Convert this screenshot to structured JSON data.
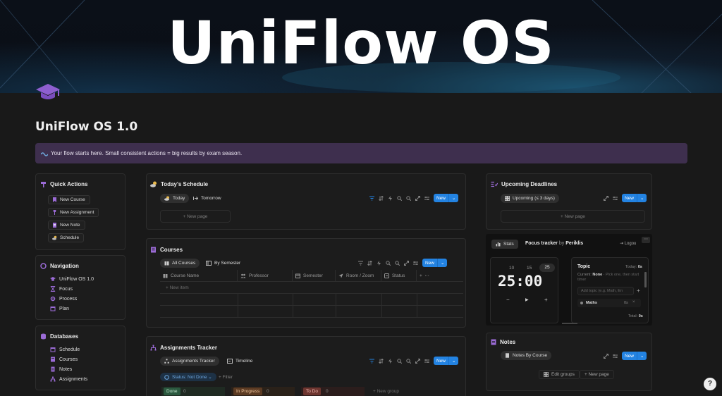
{
  "banner": {
    "title": "UniFlow OS"
  },
  "page": {
    "title": "UniFlow OS 1.0"
  },
  "callout": {
    "text": "Your flow starts here. Small consistent actions = big results by exam season."
  },
  "quick_actions": {
    "title": "Quick Actions",
    "buttons": [
      "New Course",
      "New Assignment",
      "New Note",
      "Schedule"
    ]
  },
  "navigation": {
    "title": "Navigation",
    "items": [
      "UniFlow OS 1.0",
      "Focus",
      "Process",
      "Plan"
    ]
  },
  "databases": {
    "title": "Databases",
    "items": [
      "Schedule",
      "Courses",
      "Notes",
      "Assignments"
    ]
  },
  "schedule": {
    "title": "Today's Schedule",
    "views": [
      "Today",
      "Tomorrow"
    ],
    "new_label": "New",
    "new_page": "New page"
  },
  "courses": {
    "title": "Courses",
    "views": [
      "All Courses",
      "By Semester"
    ],
    "new_label": "New",
    "columns": [
      "Course Name",
      "Professor",
      "Semester",
      "Room / Zoom",
      "Status"
    ],
    "new_item": "New item"
  },
  "assignments": {
    "title": "Assignments Tracker",
    "views": [
      "Assignments Tracker",
      "Timeline"
    ],
    "new_label": "New",
    "filter_status": "Status: Not Done",
    "filter_add": "Filter",
    "groups": [
      {
        "name": "Done",
        "count": "0",
        "color": "#2b593f"
      },
      {
        "name": "In Progress",
        "count": "0",
        "color": "#5c3b23"
      },
      {
        "name": "To Do",
        "count": "0",
        "color": "#6e3630"
      }
    ],
    "new_group": "New group"
  },
  "deadlines": {
    "title": "Upcoming Deadlines",
    "view": "Upcoming (≤ 3 days)",
    "new_label": "New",
    "new_page": "New page"
  },
  "focus_tracker": {
    "tab": "Stats",
    "title": "Focus tracker",
    "by": "by",
    "author": "Periklis",
    "logout": "Logou",
    "presets": [
      "10",
      "15",
      "25"
    ],
    "time": "25:00",
    "controls": [
      "−",
      "▶",
      "+"
    ],
    "topic_label": "Topic",
    "today_label": "Today:",
    "today_value": "0s",
    "current_label": "Current:",
    "current_value": "None",
    "current_hint": "Pick one, then start timer",
    "add_placeholder": "Add topic (e.g. Math, En",
    "add_btn": "+",
    "topic_name": "Maths",
    "topic_time": "0s",
    "total_label": "Total:",
    "total_value": "0s"
  },
  "notes": {
    "title": "Notes",
    "view": "Notes By Course",
    "new_label": "New",
    "edit_groups": "Edit groups",
    "new_page": "New page"
  },
  "colors": {
    "accent": "#2383e2",
    "callout_bg": "#3e2f4e",
    "purple_icon": "#9b6bd6"
  }
}
